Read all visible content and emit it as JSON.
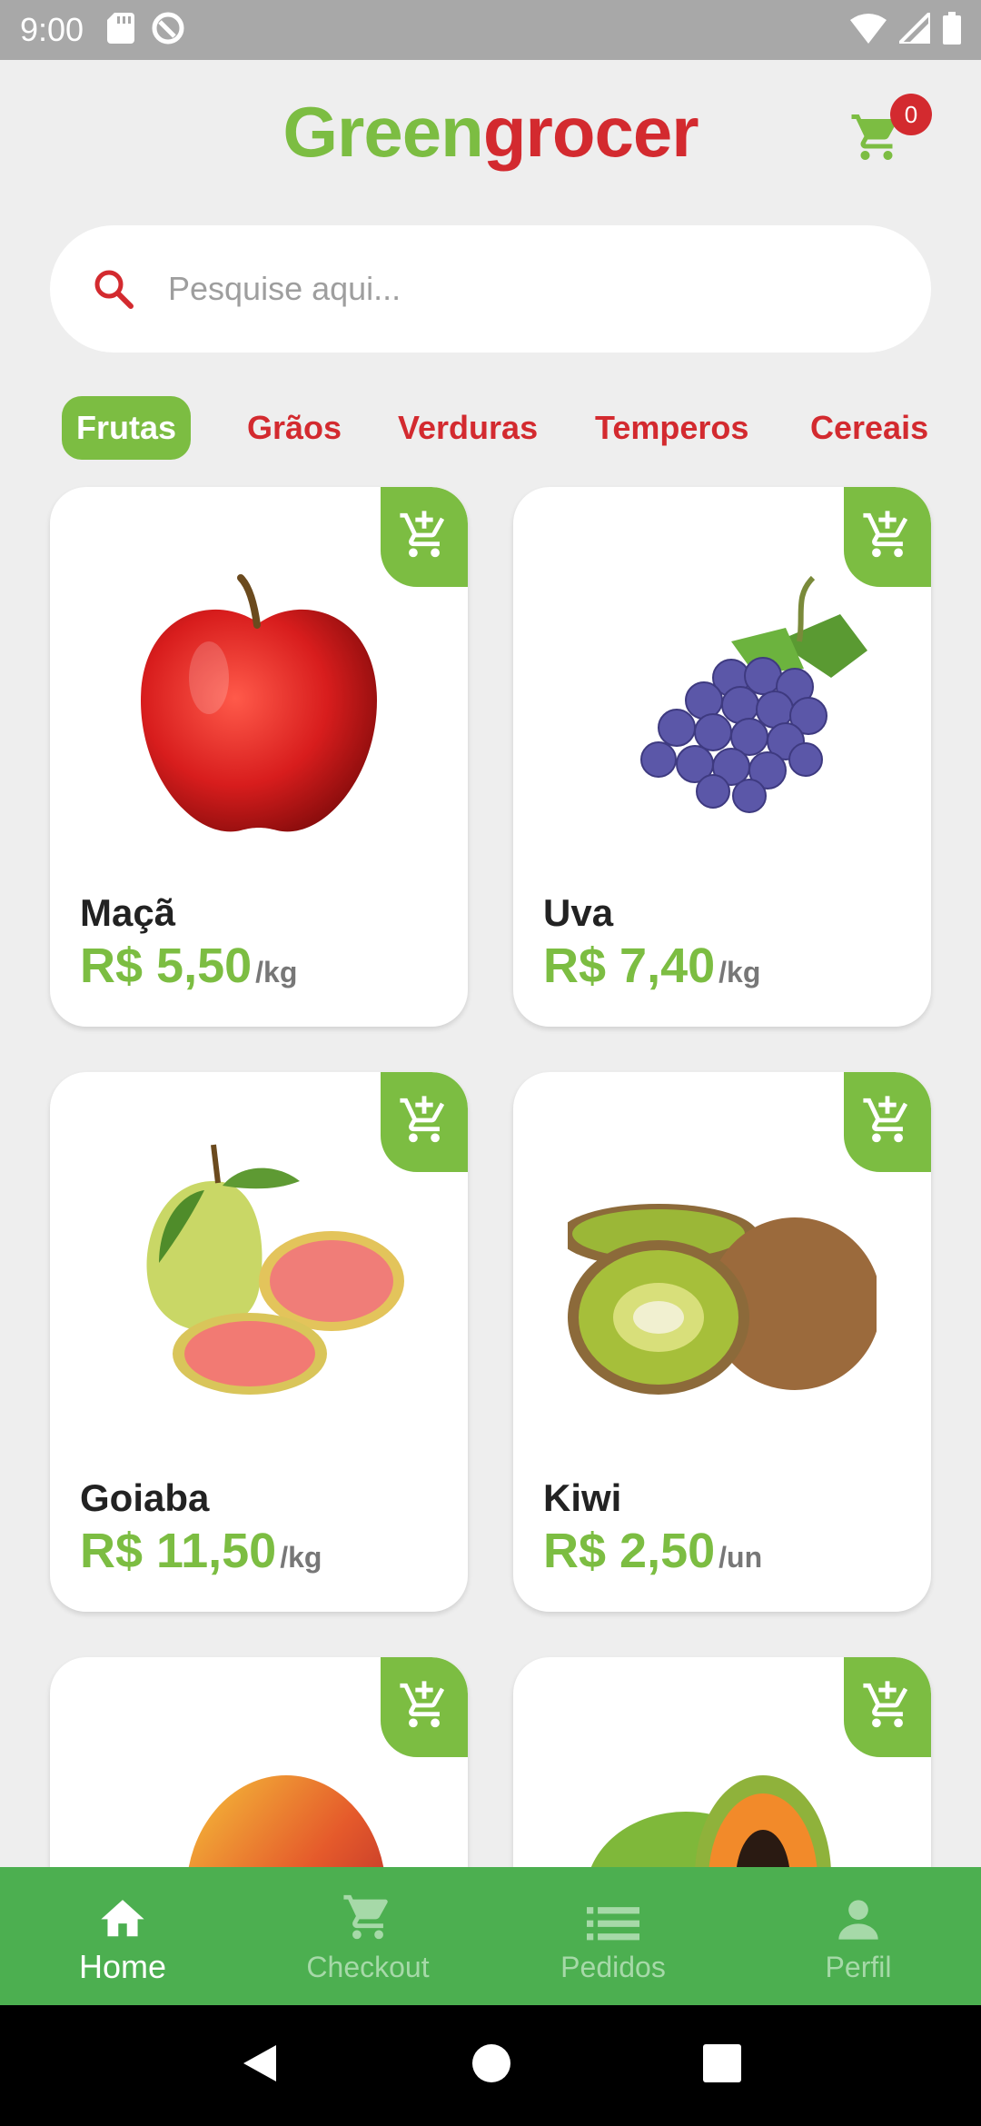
{
  "status_bar": {
    "time": "9:00"
  },
  "header": {
    "logo_part1": "Green",
    "logo_part2": "grocer",
    "cart_count": "0",
    "brand_green": "#7cbd42",
    "brand_red": "#d32a2f"
  },
  "search": {
    "placeholder": "Pesquise aqui..."
  },
  "categories": [
    {
      "label": "Frutas",
      "active": true
    },
    {
      "label": "Grãos",
      "active": false
    },
    {
      "label": "Verduras",
      "active": false
    },
    {
      "label": "Temperos",
      "active": false
    },
    {
      "label": "Cereais",
      "active": false
    }
  ],
  "products": [
    {
      "name": "Maçã",
      "price": "R$ 5,50",
      "unit": "/kg",
      "image": "apple"
    },
    {
      "name": "Uva",
      "price": "R$ 7,40",
      "unit": "/kg",
      "image": "grapes"
    },
    {
      "name": "Goiaba",
      "price": "R$ 11,50",
      "unit": "/kg",
      "image": "guava"
    },
    {
      "name": "Kiwi",
      "price": "R$ 2,50",
      "unit": "/un",
      "image": "kiwi"
    },
    {
      "name": "",
      "price": "",
      "unit": "",
      "image": "mango"
    },
    {
      "name": "",
      "price": "",
      "unit": "",
      "image": "papaya"
    }
  ],
  "bottom_nav": [
    {
      "label": "Home",
      "icon": "home-icon",
      "active": true
    },
    {
      "label": "Checkout",
      "icon": "cart-icon",
      "active": false
    },
    {
      "label": "Pedidos",
      "icon": "list-icon",
      "active": false
    },
    {
      "label": "Perfil",
      "icon": "person-icon",
      "active": false
    }
  ]
}
